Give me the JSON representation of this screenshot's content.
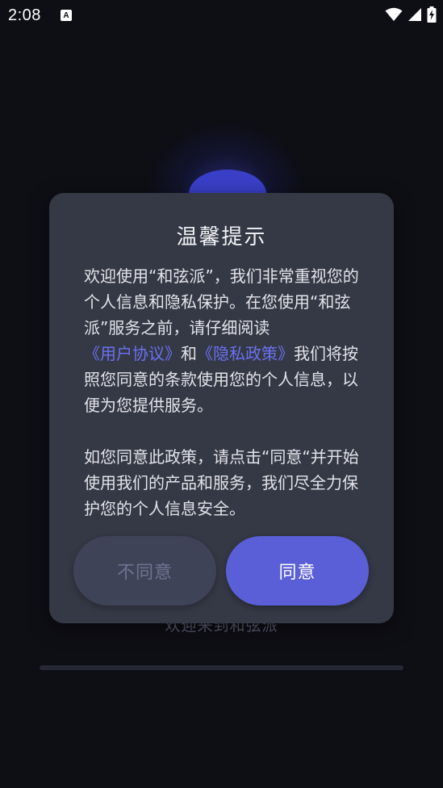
{
  "status_bar": {
    "time": "2:08",
    "notification_badge": "A",
    "icons": [
      "wifi-icon",
      "signal-icon",
      "battery-charging-icon"
    ]
  },
  "splash": {
    "welcome_text": "欢迎来到和弦派"
  },
  "dialog": {
    "title": "温馨提示",
    "paragraph1": {
      "part1": "欢迎使用“和弦派”，我们非常重视您的个人信息和隐私保护。在您使用“和弦派”服务之前，请仔细阅读",
      "user_agreement_link": "《用户协议》",
      "and": "和",
      "privacy_policy_link": "《隐私政策》",
      "part2": "我们将按照您同意的条款使用您的个人信息，以便为您提供服务。"
    },
    "paragraph2": "如您同意此政策，请点击“同意“并开始使用我们的产品和服务，我们尽全力保护您的个人信息安全。",
    "disagree_label": "不同意",
    "agree_label": "同意"
  },
  "colors": {
    "background": "#0e0e15",
    "dialog": "#353845",
    "link": "#6a72f0",
    "agree_button": "#5a5fd8",
    "disagree_button": "#3f4358"
  }
}
